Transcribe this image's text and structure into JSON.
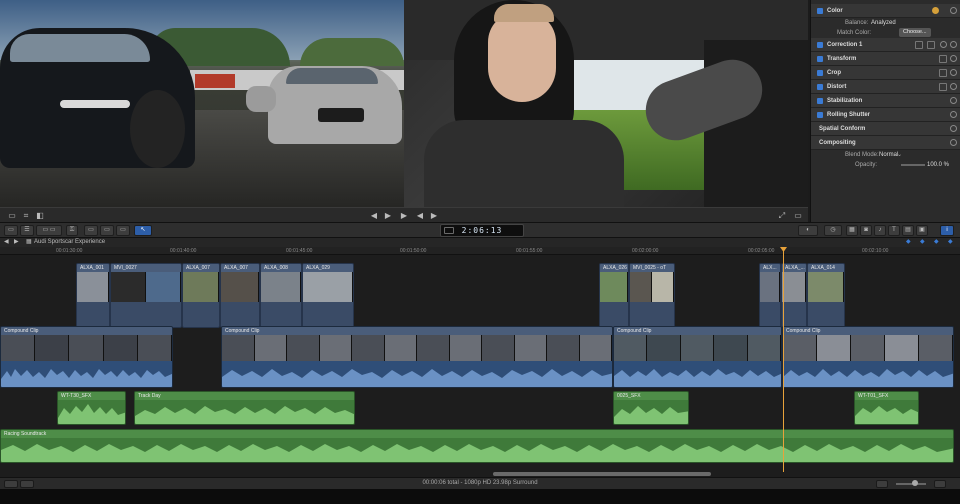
{
  "inspector": {
    "color_label": "Color",
    "balance_label": "Balance:",
    "balance_value": "Analyzed",
    "match_color_label": "Match Color:",
    "choose_label": "Choose...",
    "correction_label": "Correction 1",
    "transform_label": "Transform",
    "crop_label": "Crop",
    "distort_label": "Distort",
    "stabilization_label": "Stabilization",
    "rolling_shutter_label": "Rolling Shutter",
    "spatial_conform_label": "Spatial Conform",
    "compositing_label": "Compositing",
    "blend_mode_label": "Blend Mode:",
    "blend_mode_value": "Normal",
    "opacity_label": "Opacity:",
    "opacity_value": "100.0 %"
  },
  "toolbar": {
    "timecode": "2:06:13"
  },
  "timeline": {
    "project_name": "Audi Sportscar Experience",
    "ruler": [
      "00:01:30:00",
      "00:01:40:00",
      "00:01:45:00",
      "00:01:50:00",
      "00:01:55:00",
      "00:02:00:00",
      "00:02:05:00",
      "00:02:10:00"
    ],
    "connected_clips": [
      {
        "label": "ALXA_001"
      },
      {
        "label": "MVI_0027"
      },
      {
        "label": "ALXA_007"
      },
      {
        "label": "ALXA_007"
      },
      {
        "label": "ALXA_008"
      },
      {
        "label": "ALXA_029"
      },
      {
        "label": "ALXA_026"
      },
      {
        "label": "MVI_0025 - oT"
      },
      {
        "label": "ALX..."
      },
      {
        "label": "ALXA_..."
      },
      {
        "label": "ALXA_014"
      }
    ],
    "primary_clips": [
      {
        "label": "Compound Clip"
      },
      {
        "label": "Compound Clip"
      },
      {
        "label": "Compound Clip"
      },
      {
        "label": "Compound Clip"
      }
    ],
    "sfx_clips": [
      {
        "label": "WT-T30_SFX"
      },
      {
        "label": "Track Day"
      },
      {
        "label": "0025_SFX"
      },
      {
        "label": "WT-T01_SFX"
      }
    ],
    "soundtrack_label": "Racing Soundtrack"
  },
  "status": {
    "text": "00:00:06 total - 1080p HD 23.98p Surround"
  },
  "colors": {
    "accent": "#2d5ea8",
    "playhead": "#e8a23a",
    "connected_clip": "#3a4b66",
    "audio_green": "#3f7a3a"
  }
}
